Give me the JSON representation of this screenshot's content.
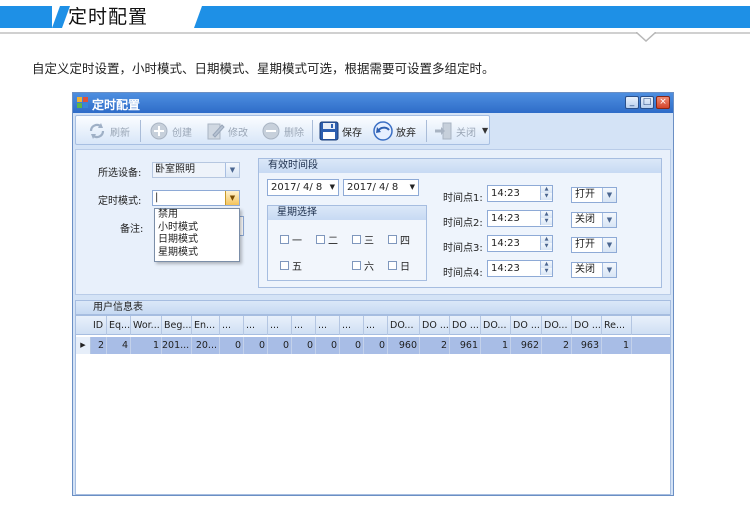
{
  "page": {
    "title": "定时配置",
    "description": "自定义定时设置，小时模式、日期模式、星期模式可选，根据需要可设置多组定时。"
  },
  "window": {
    "title": "定时配置",
    "controls": {
      "minimize": "_",
      "maximize": "□",
      "close": "×"
    }
  },
  "toolbar": {
    "refresh": "刷新",
    "create": "创建",
    "edit": "修改",
    "delete": "删除",
    "save": "保存",
    "discard": "放弃",
    "close": "关闭"
  },
  "form": {
    "device_label": "所选设备:",
    "device_value": "卧室照明",
    "mode_label": "定时模式:",
    "mode_value": "|",
    "mode_options": [
      "禁用",
      "小时模式",
      "日期模式",
      "星期模式"
    ],
    "note_label": "备注:",
    "valid_period_title": "有效时间段",
    "date_from": "2017/ 4/ 8",
    "date_to": "2017/ 4/ 8",
    "week_title": "星期选择",
    "weekdays": [
      "一",
      "二",
      "三",
      "四",
      "五",
      "六",
      "日"
    ],
    "timepoints": [
      {
        "label": "时间点1:",
        "time": "14:23",
        "action": "打开"
      },
      {
        "label": "时间点2:",
        "time": "14:23",
        "action": "关闭"
      },
      {
        "label": "时间点3:",
        "time": "14:23",
        "action": "打开"
      },
      {
        "label": "时间点4:",
        "time": "14:23",
        "action": "关闭"
      }
    ]
  },
  "grid": {
    "title": "用户信息表",
    "headers": [
      "ID",
      "Eq...",
      "Wor...",
      "Beg...",
      "En...",
      "...",
      "...",
      "...",
      "...",
      "...",
      "...",
      "...",
      "DO...",
      "DO ...",
      "DO ...",
      "DO...",
      "DO ...",
      "DO...",
      "DO ...",
      "Re..."
    ],
    "rows": [
      [
        "2",
        "4",
        "1",
        "201...",
        "20...",
        "0",
        "0",
        "0",
        "0",
        "0",
        "0",
        "0",
        "960",
        "2",
        "961",
        "1",
        "962",
        "2",
        "963",
        "1",
        ""
      ]
    ]
  },
  "colors": {
    "banner": "#1e90e6",
    "window_title": "#2e6cc8",
    "selected_row": "#a8bde6"
  }
}
